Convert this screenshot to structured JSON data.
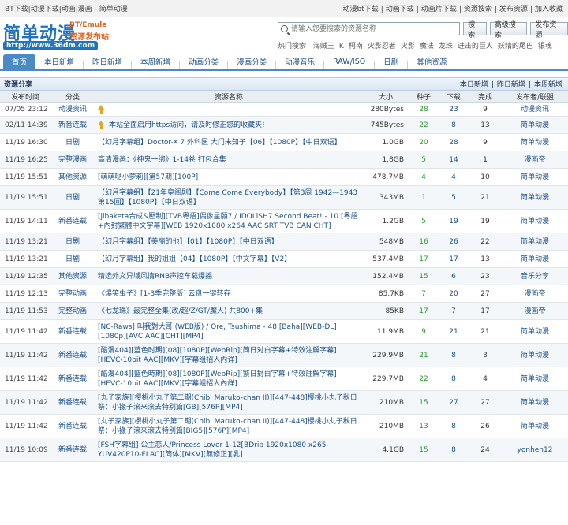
{
  "window_title": "BT下载|动漫下载|动画|漫画 - 简单动漫",
  "top_links": [
    "动漫bt下载",
    "|",
    "动画下载",
    "|",
    "动画片下载",
    "|",
    "资源搜索",
    "|",
    "发布资源",
    "|",
    "加入收藏"
  ],
  "logo": {
    "big": "简单动漫",
    "bt": "BT/Emule",
    "pub": "资源发布站",
    "url": "http://www.36dm.com"
  },
  "search": {
    "placeholder": "请输入您要搜索的资源名称",
    "search_label": "搜索",
    "advanced_label": "高级搜索",
    "publish_label": "发布资源"
  },
  "hot": {
    "label": "热门搜索",
    "keywords": [
      "海贼王",
      "K",
      "柯南",
      "火影忍者",
      "火影",
      "魔法",
      "龙珠",
      "进击的巨人",
      "妖精的尾巴",
      "银魂"
    ]
  },
  "nav": [
    "首页",
    "本日新增",
    "昨日新增",
    "本周新增",
    "动画分类",
    "漫画分类",
    "动漫音乐",
    "RAW/ISO",
    "日剧",
    "其他资源"
  ],
  "section": {
    "title": "资源分享",
    "links": [
      "本日新增",
      "|",
      "昨日新增",
      "|",
      "本周新增"
    ]
  },
  "columns": [
    "发布时间",
    "分类",
    "资源名称",
    "大小",
    "种子",
    "下载",
    "完成",
    "发布者/联盟"
  ],
  "rows": [
    {
      "date": "07/05 23:12",
      "cat": "动漫资讯",
      "title": "",
      "pin": "big",
      "size": "280Bytes",
      "seed": "28",
      "dl": "23",
      "done": "9",
      "pub": "动漫资讯"
    },
    {
      "date": "02/11 14:39",
      "cat": "新番连载",
      "title": "本站全面启用https访问，请及时修正您的收藏夹!",
      "pin": "small",
      "size": "745Bytes",
      "seed": "22",
      "dl": "8",
      "done": "13",
      "pub": "简单动漫"
    },
    {
      "date": "11/19 16:30",
      "cat": "日剧",
      "title": "【幻月字幕组】Doctor-X 7 外科医 大门未知子【06】【1080P】【中日双语】",
      "size": "1.0GB",
      "seed": "20",
      "dl": "28",
      "done": "9",
      "pub": "简单动漫"
    },
    {
      "date": "11/19 16:25",
      "cat": "完整漫画",
      "title": "高清漫画：《神鬼一绑》1-14卷 打包合集",
      "size": "1.8GB",
      "seed": "5",
      "dl": "14",
      "done": "1",
      "pub": "漫画帝"
    },
    {
      "date": "11/19 15:51",
      "cat": "其他资源",
      "title": "[萌萌哒小萝莉][第57期][100P]",
      "size": "478.7MB",
      "seed": "4",
      "dl": "4",
      "done": "10",
      "pub": "简单动漫"
    },
    {
      "date": "11/19 15:51",
      "cat": "日剧",
      "title": "【幻月字幕组】【21年皇阁剧】【Come Come Everybody】【第3周 1942—1943第15回】【1080P】【中日双语】",
      "size": "343MB",
      "seed": "1",
      "dl": "5",
      "done": "21",
      "pub": "简单动漫"
    },
    {
      "date": "11/19 14:11",
      "cat": "新番连载",
      "title": "[jibaketa合成&壓制][TVB粵語]偶像星願7 / IDOLiSH7 Second Beat! - 10 [粵語+內封繁體中文字幕][WEB 1920x1080 x264 AAC SRT TVB CAN CHT]",
      "size": "1.2GB",
      "seed": "5",
      "dl": "19",
      "done": "19",
      "pub": "简单动漫"
    },
    {
      "date": "11/19 13:21",
      "cat": "日剧",
      "title": "【幻月字幕组】【美丽的他】【01】【1080P】【中日双语】",
      "size": "548MB",
      "seed": "16",
      "dl": "26",
      "done": "22",
      "pub": "简单动漫"
    },
    {
      "date": "11/19 13:21",
      "cat": "日剧",
      "title": "【幻月字幕组】我的姐姐【04】【1080P】【中文字幕】【V2】",
      "size": "537.4MB",
      "seed": "17",
      "dl": "17",
      "done": "13",
      "pub": "简单动漫"
    },
    {
      "date": "11/19 12:35",
      "cat": "其他资源",
      "title": "精选外文异域风情RNB声控车载爆摇",
      "size": "152.4MB",
      "seed": "15",
      "dl": "6",
      "done": "23",
      "pub": "音乐分享"
    },
    {
      "date": "11/19 12:13",
      "cat": "完整动画",
      "title": "《爆笑虫子》[1-3季完整版] 云盘一键转存",
      "size": "85.7KB",
      "seed": "7",
      "dl": "20",
      "done": "27",
      "pub": "漫画帝"
    },
    {
      "date": "11/19 11:53",
      "cat": "完整动画",
      "title": "《七龙珠》最完整全集(改/超/Z/GT/魔人) 共800+集",
      "size": "85KB",
      "seed": "17",
      "dl": "7",
      "done": "17",
      "pub": "漫画帝"
    },
    {
      "date": "11/19 11:42",
      "cat": "新番连载",
      "title": "[NC-Raws] 叫我對大哥 (WEB版) / Ore, Tsushima - 48 [Baha][WEB-DL][1080p][AVC AAC][CHT][MP4]",
      "size": "11.9MB",
      "seed": "9",
      "dl": "21",
      "done": "21",
      "pub": "简单动漫"
    },
    {
      "date": "11/19 11:42",
      "cat": "新番连载",
      "title": "[酷漫404][蓝色时期][08][1080P][WebRip][简日对白字幕+特效注解字幕][HEVC-10bit AAC][MKV][字幕组招人内详]",
      "size": "229.9MB",
      "seed": "21",
      "dl": "8",
      "done": "3",
      "pub": "简单动漫"
    },
    {
      "date": "11/19 11:42",
      "cat": "新番连载",
      "title": "[酷漫404][藍色時期][08][1080P][WebRip][繁日對白字幕+特效註解字幕][HEVC-10bit AAC][MKV][字幕組招人內詳]",
      "size": "229.7MB",
      "seed": "22",
      "dl": "8",
      "done": "4",
      "pub": "简单动漫"
    },
    {
      "date": "11/19 11:42",
      "cat": "新番连载",
      "title": "[丸子家族][樱桃小丸子第二期(Chibi Maruko-chan II)][447-448]樱桃小丸子秋日祭：小掾子滚来滚去特别篇[GB][576P][MP4]",
      "size": "210MB",
      "seed": "15",
      "dl": "27",
      "done": "27",
      "pub": "简单动漫"
    },
    {
      "date": "11/19 11:42",
      "cat": "新番连载",
      "title": "[丸子家族][櫻桃小丸子第二期(Chibi Maruko-chan II)][447-448]櫻桃小丸子秋日祭：小掾子滾來滾去特別篇[BIG5][576P][MP4]",
      "size": "210MB",
      "seed": "13",
      "dl": "8",
      "done": "26",
      "pub": "简单动漫"
    },
    {
      "date": "11/19 10:09",
      "cat": "新番连载",
      "title": "[FSH字幕组] 公主恋人/Princess Lover 1-12[BDrip 1920x1080 x265-YUV420P10-FLAC][简体][MKV][無修正][乳]",
      "size": "4.1GB",
      "seed": "15",
      "dl": "8",
      "done": "24",
      "pub": "yonhen12"
    }
  ]
}
